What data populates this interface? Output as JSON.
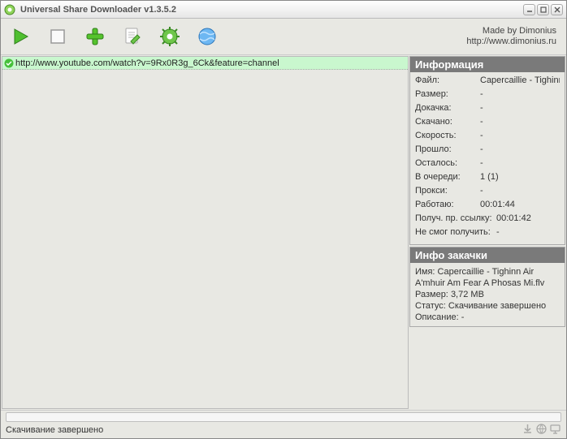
{
  "window": {
    "title": "Universal Share Downloader v1.3.5.2"
  },
  "credits": {
    "line1": "Made by Dimonius",
    "line2": "http://www.dimonius.ru"
  },
  "list": {
    "items": [
      {
        "url": "http://www.youtube.com/watch?v=9Rx0R3g_6Ck&feature=channel"
      }
    ]
  },
  "info_panel": {
    "header": "Информация",
    "rows": {
      "file_label": "Файл:",
      "file_value": "Capercaillie - Tighinn Air A'r",
      "size_label": "Размер:",
      "size_value": "-",
      "resume_label": "Докачка:",
      "resume_value": "-",
      "downloaded_label": "Скачано:",
      "downloaded_value": "-",
      "speed_label": "Скорость:",
      "speed_value": "-",
      "elapsed_label": "Прошло:",
      "elapsed_value": "-",
      "remaining_label": "Осталось:",
      "remaining_value": "-",
      "queue_label": "В очереди:",
      "queue_value": "1 (1)",
      "proxy_label": "Прокси:",
      "proxy_value": "-",
      "working_label": "Работаю:",
      "working_value": "00:01:44",
      "directlink_label": "Получ. пр. ссылку:",
      "directlink_value": "00:01:42",
      "failed_label": "Не смог получить:",
      "failed_value": "-"
    }
  },
  "download_panel": {
    "header": "Инфо закачки",
    "name_label": "Имя:",
    "name_value": "Capercaillie - Tighinn Air A'mhuir Am Fear A Phosas Mi.flv",
    "size_label": "Размер:",
    "size_value": "3,72 MB",
    "status_label": "Статус:",
    "status_value": "Скачивание завершено",
    "desc_label": "Описание:",
    "desc_value": "-"
  },
  "statusbar": {
    "text": "Скачивание завершено"
  }
}
